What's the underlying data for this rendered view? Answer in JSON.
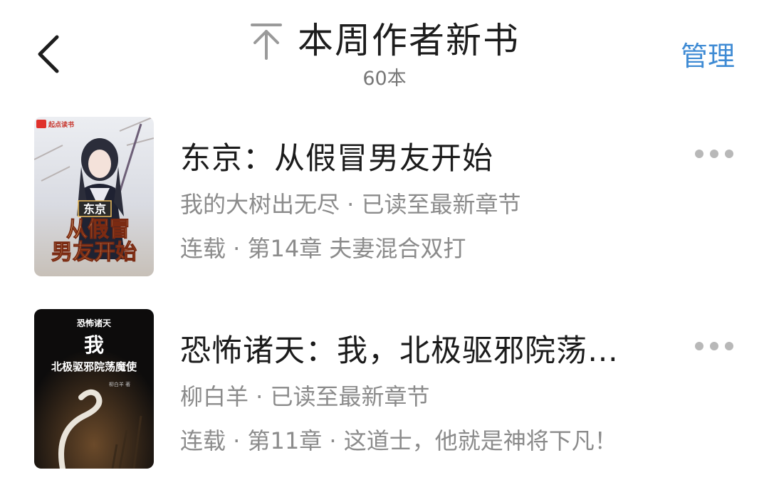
{
  "header": {
    "title": "本周作者新书",
    "count": "60本",
    "manage_label": "管理"
  },
  "books": [
    {
      "title": "东京：从假冒男友开始",
      "author_status": "我的大树出无尽 · 已读至最新章节",
      "progress": "连载 · 第14章 夫妻混合双打",
      "cover": {
        "brand": "起点读书",
        "title_line1": "东京",
        "title_line2": "从假冒",
        "title_line3": "男友开始"
      }
    },
    {
      "title": "恐怖诸天：我，北极驱邪院荡…",
      "author_status": "柳白羊 · 已读至最新章节",
      "progress": "连载 · 第11章 · 这道士，他就是神将下凡！",
      "cover": {
        "line1": "恐怖诸天",
        "line2": "我",
        "line3": "北极驱邪院荡魔使",
        "author": "柳白羊 著"
      }
    }
  ],
  "colors": {
    "accent": "#3f8bd4",
    "title_text": "#1b1b1b",
    "meta_text": "#8b8b8b",
    "more_dots": "#b8b8b8"
  }
}
